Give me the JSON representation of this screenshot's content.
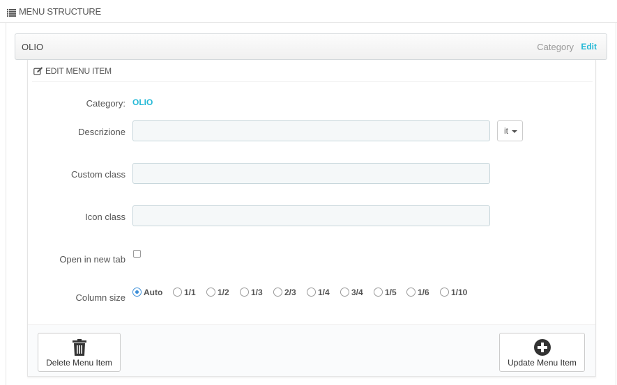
{
  "header": {
    "title": "MENU STRUCTURE",
    "icon": "list-icon"
  },
  "menu_item": {
    "name": "OLIO",
    "type": "Category",
    "edit_label": "Edit",
    "accent": "#25b9d7"
  },
  "edit_panel": {
    "title": "EDIT MENU ITEM",
    "icon": "pencil-square-icon",
    "category_label": "Category:",
    "category_value": "OLIO",
    "descrizione_label": "Descrizione",
    "descrizione_value": "",
    "language": "it",
    "custom_class_label": "Custom class",
    "custom_class_value": "",
    "icon_class_label": "Icon class",
    "icon_class_value": "",
    "open_new_tab_label": "Open in new tab",
    "open_new_tab_checked": false,
    "column_size_label": "Column size",
    "column_sizes": [
      "Auto",
      "1/1",
      "1/2",
      "1/3",
      "2/3",
      "1/4",
      "3/4",
      "1/5",
      "1/6",
      "1/10"
    ],
    "column_size_selected": "Auto"
  },
  "footer": {
    "delete_label": "Delete Menu Item",
    "delete_icon": "trash-icon",
    "update_label": "Update Menu Item",
    "update_icon": "plus-circle-icon"
  }
}
